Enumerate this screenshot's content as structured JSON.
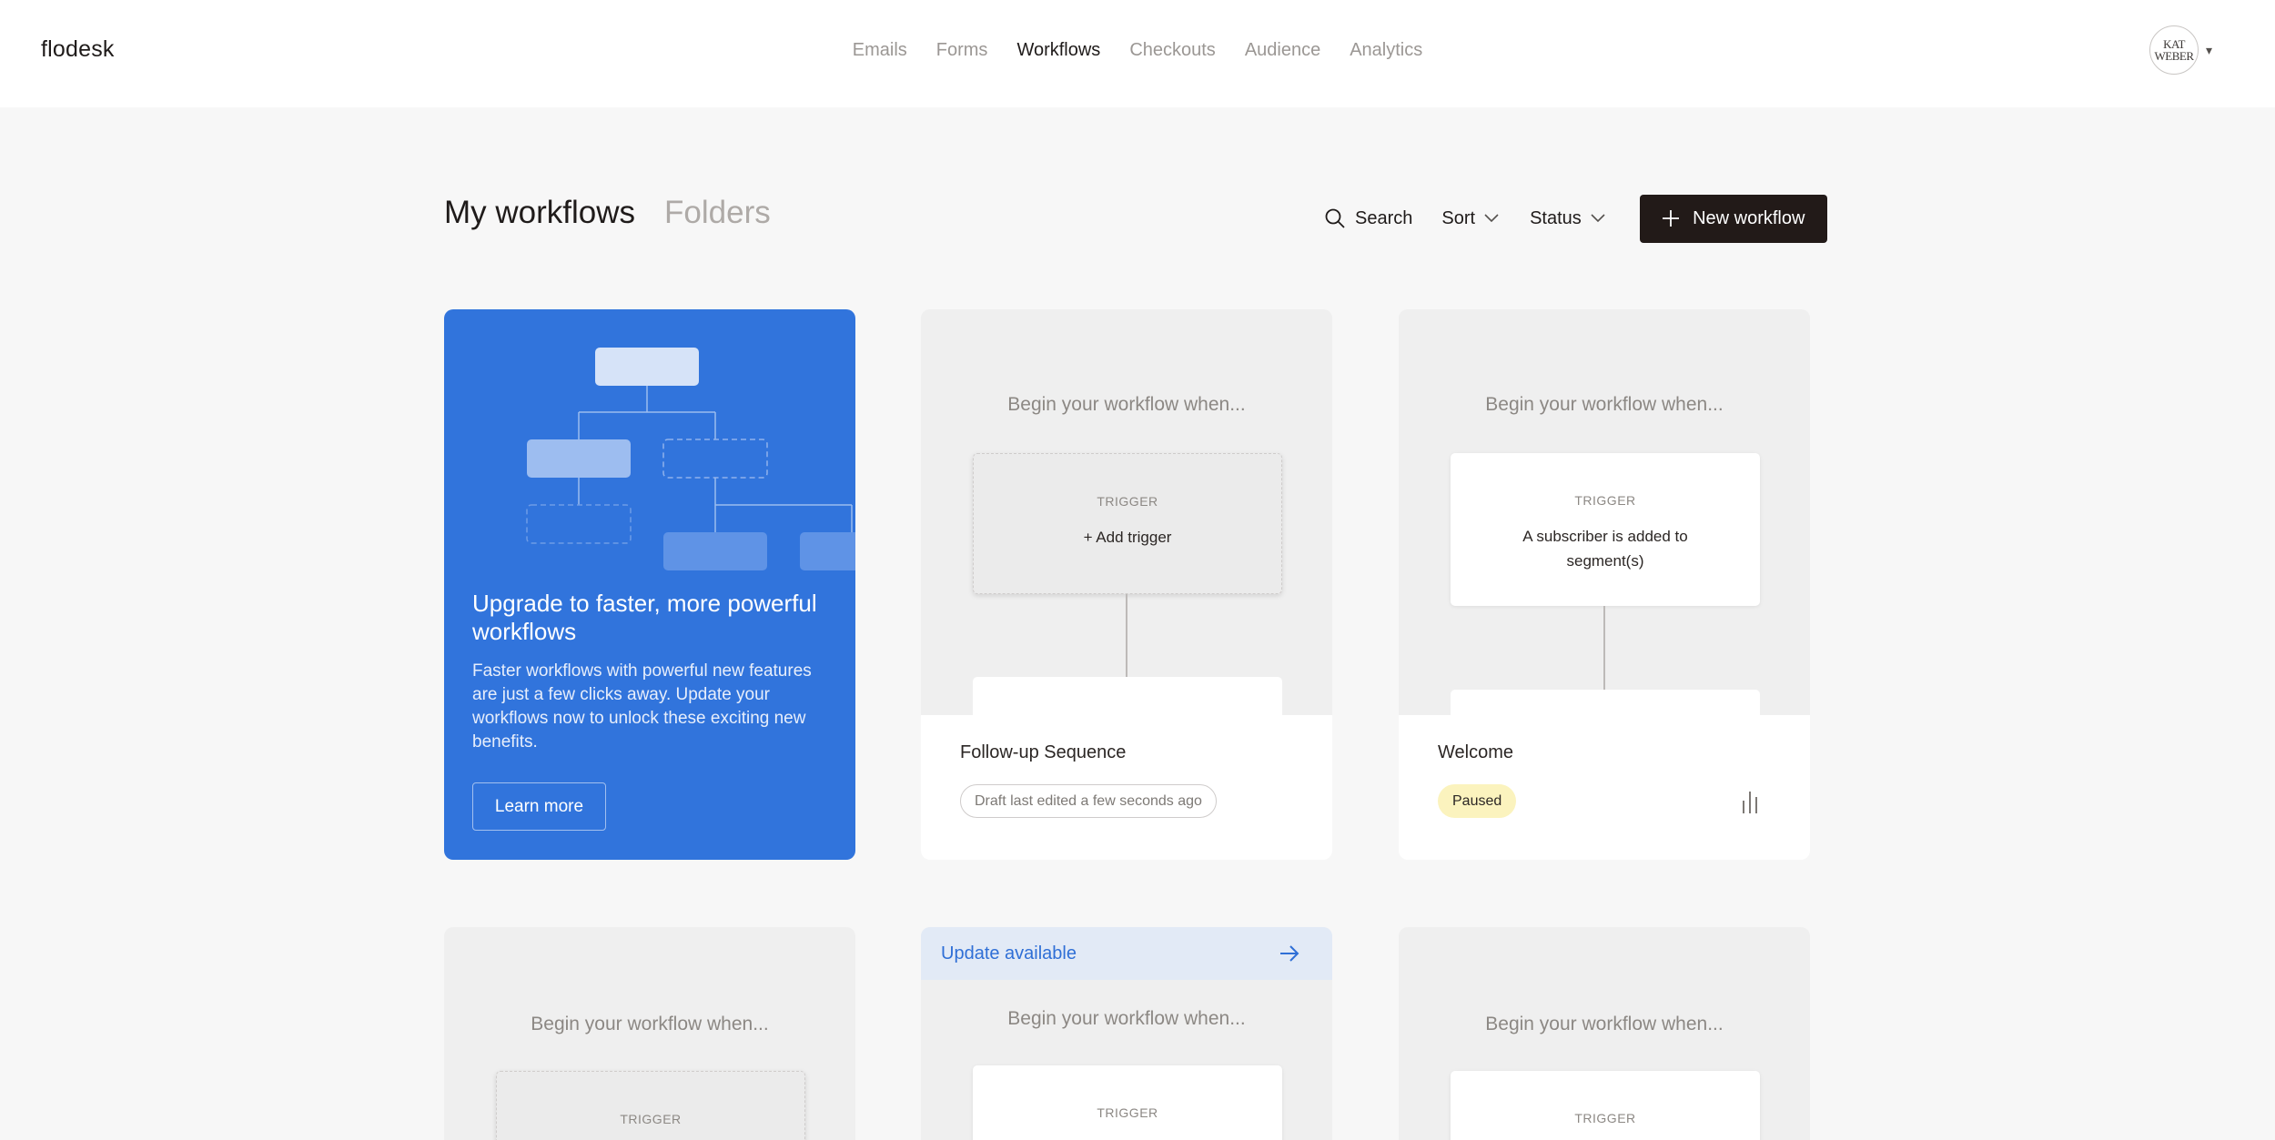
{
  "app": {
    "logo": "flodesk"
  },
  "nav": {
    "items": [
      "Emails",
      "Forms",
      "Workflows",
      "Checkouts",
      "Audience",
      "Analytics"
    ],
    "active": "Workflows"
  },
  "user": {
    "avatar_text_line1": "KAT",
    "avatar_text_line2": "WEBER"
  },
  "header": {
    "tab_active": "My workflows",
    "tab_inactive": "Folders",
    "search_label": "Search",
    "sort_label": "Sort",
    "status_label": "Status",
    "new_workflow_label": "New workflow"
  },
  "promo": {
    "title": "Upgrade to faster, more powerful workflows",
    "body": "Faster workflows with powerful new features are just a few clicks away. Update your workflows now to unlock these exciting new benefits.",
    "button": "Learn more"
  },
  "cards": [
    {
      "begin": "Begin your workflow when...",
      "trigger_label": "TRIGGER",
      "trigger_text": "+ Add trigger",
      "name": "Follow-up Sequence",
      "status": "Draft last edited a few seconds ago"
    },
    {
      "begin": "Begin your workflow when...",
      "trigger_label": "TRIGGER",
      "trigger_text": "A subscriber is added to segment(s)",
      "name": "Welcome",
      "status": "Paused"
    },
    {
      "begin": "Begin your workflow when...",
      "trigger_label": "TRIGGER"
    },
    {
      "update": "Update available",
      "begin": "Begin your workflow when...",
      "trigger_label": "TRIGGER"
    },
    {
      "begin": "Begin your workflow when...",
      "trigger_label": "TRIGGER"
    }
  ],
  "colors": {
    "primary_button": "#221a18",
    "promo_blue": "#3174dc",
    "update_blue": "#2f6fd6",
    "paused_bg": "#fbf3be"
  }
}
